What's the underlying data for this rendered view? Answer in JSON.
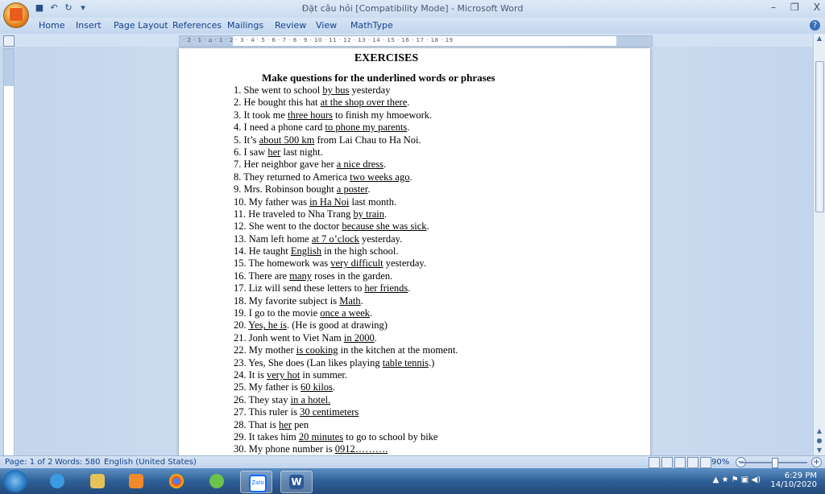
{
  "window": {
    "title": "Đặt câu hỏi [Compatibility Mode] - Microsoft Word",
    "minimize": "–",
    "restore": "❐",
    "close": "X"
  },
  "qat": {
    "save": "■",
    "undo": "↶",
    "redo": "↻",
    "more": "▾"
  },
  "ribbon": {
    "tabs": [
      "Home",
      "Insert",
      "Page Layout",
      "References",
      "Mailings",
      "Review",
      "View",
      "MathType"
    ],
    "help": "?"
  },
  "ruler_text": "· 2 · 1 · ⌂ · 1 · 2 · 3 · 4 · 5 · 6 · 7 · 8 · 9 · 10 · 11 · 12 · 13 · 14 · 15 · 16 · 17 · 18 · 19",
  "document": {
    "title": "EXERCISES",
    "subtitle": "Make questions for the underlined words or phrases",
    "lines": [
      {
        "pre": "1. She went to school ",
        "u": "by bus",
        "post": " yesterday"
      },
      {
        "pre": "2. He bought this hat ",
        "u": "at the shop over there",
        "post": "."
      },
      {
        "pre": "3. It took me ",
        "u": "three hours",
        "post": " to finish my hmoework."
      },
      {
        "pre": "4. I need a phone card ",
        "u": "to phone my parents",
        "post": "."
      },
      {
        "pre": "5. It’s ",
        "u": "about 500 km",
        "post": " from Lai Chau to Ha Noi."
      },
      {
        "pre": "6. I saw ",
        "u": "her",
        "post": " last night."
      },
      {
        "pre": "7. Her neighbor gave her ",
        "u": "a nice dress",
        "post": "."
      },
      {
        "pre": "8. They returned to America ",
        "u": "two weeks ago",
        "post": "."
      },
      {
        "pre": "9. Mrs. Robinson bought ",
        "u": "a poster",
        "post": "."
      },
      {
        "pre": "10. My father was ",
        "u": "in Ha Noi",
        "post": " last month."
      },
      {
        "pre": "11. He traveled to Nha Trang ",
        "u": "by train",
        "post": "."
      },
      {
        "pre": "12. She went to the doctor ",
        "u": "because she was sick",
        "post": "."
      },
      {
        "pre": "13. Nam left home ",
        "u": "at 7 o’clock",
        "post": " yesterday."
      },
      {
        "pre": "14. He taught ",
        "u": "English",
        "post": " in the high school."
      },
      {
        "pre": "15. The homework was ",
        "u": "very difficult",
        "post": " yesterday."
      },
      {
        "pre": "16. There are ",
        "u": "many",
        "post": " roses in the garden."
      },
      {
        "pre": "17. Liz will send these letters to ",
        "u": "her friends",
        "post": "."
      },
      {
        "pre": "18. My favorite subject is ",
        "u": "Math",
        "post": "."
      },
      {
        "pre": "19.  I go to the movie ",
        "u": "once a week",
        "post": "."
      },
      {
        "pre": "20. ",
        "u": "Yes, he is",
        "post": ". (He is good at drawing)"
      },
      {
        "pre": "21. Jonh went to Viet Nam ",
        "u": "in 2000",
        "post": "."
      },
      {
        "pre": "22. My mother ",
        "u": "is cooking",
        "post": " in the kitchen at the moment."
      },
      {
        "pre": "23. Yes, She does (Lan likes playing ",
        "u": "table tennis",
        "post": ".)"
      },
      {
        "pre": "24. It is ",
        "u": "very hot",
        "post": " in summer."
      },
      {
        "pre": "25. My father is ",
        "u": "60 kilos",
        "post": "."
      },
      {
        "pre": "26. They stay ",
        "u": "in a hotel.",
        "post": ""
      },
      {
        "pre": "27. This ruler is ",
        "u": "30 centimeters",
        "post": ""
      },
      {
        "pre": "28. That is ",
        "u": "her",
        "post": " pen"
      },
      {
        "pre": "29. It takes him ",
        "u": "20 minutes",
        "post": " to go to school by bike"
      },
      {
        "pre": "30. My phone number is ",
        "u": "0912……….",
        "post": ""
      }
    ]
  },
  "status": {
    "page": "Page: 1 of 2",
    "words": "Words: 580",
    "language": "English (United States)",
    "zoom": "90%",
    "zoom_minus": "−",
    "zoom_plus": "+"
  },
  "taskbar": {
    "apps": [
      "internet-explorer",
      "file-explorer",
      "media-player",
      "chrome",
      "unikey",
      "zalo",
      "word"
    ],
    "zalo_label": "Zalo",
    "word_label": "W",
    "time": "6:29 PM",
    "date": "14/10/2020",
    "tray_symbols": "▲ ★ ⚑ ▣ ◀)"
  },
  "colors": {
    "accent": "#15428b",
    "taskbar": "#2f5f97"
  }
}
